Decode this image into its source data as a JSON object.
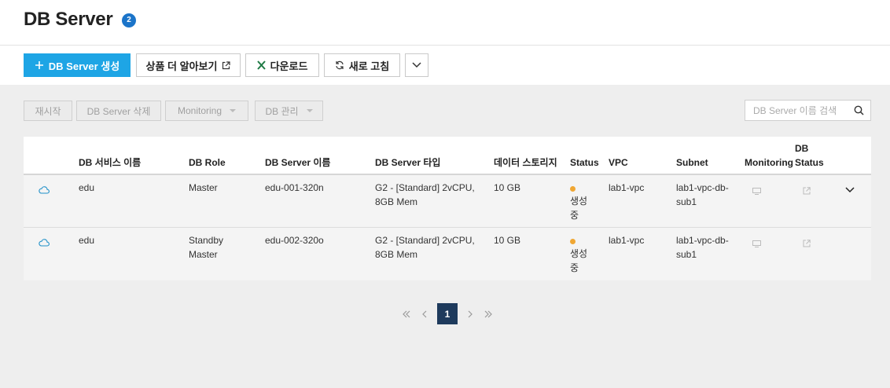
{
  "header": {
    "title": "DB Server",
    "count": "2"
  },
  "toolbar": {
    "create_label": "DB Server 생성",
    "learn_more_label": "상품 더 알아보기",
    "download_label": "다운로드",
    "refresh_label": "새로 고침"
  },
  "actions": {
    "restart_label": "재시작",
    "delete_label": "DB Server 삭제",
    "monitoring_label": "Monitoring",
    "db_manage_label": "DB 관리"
  },
  "search": {
    "placeholder": "DB Server 이름 검색"
  },
  "table": {
    "columns": {
      "service_name": "DB 서비스 이름",
      "role": "DB Role",
      "server_name": "DB Server 이름",
      "server_type": "DB Server 타입",
      "storage": "데이터 스토리지",
      "status": "Status",
      "vpc": "VPC",
      "subnet": "Subnet",
      "monitoring": "Monitoring",
      "db_status_1": "DB",
      "db_status_2": "Status"
    },
    "rows": [
      {
        "service_name": "edu",
        "role_1": "Master",
        "role_2": "",
        "server_name": "edu-001-320n",
        "server_type_1": "G2 - [Standard] 2vCPU,",
        "server_type_2": "8GB Mem",
        "storage": "10 GB",
        "status_1": "생성",
        "status_2": "중",
        "vpc": "lab1-vpc",
        "subnet_1": "lab1-vpc-db-",
        "subnet_2": "sub1"
      },
      {
        "service_name": "edu",
        "role_1": "Standby",
        "role_2": "Master",
        "server_name": "edu-002-320o",
        "server_type_1": "G2 - [Standard] 2vCPU,",
        "server_type_2": "8GB Mem",
        "storage": "10 GB",
        "status_1": "생성",
        "status_2": "중",
        "vpc": "lab1-vpc",
        "subnet_1": "lab1-vpc-db-",
        "subnet_2": "sub1"
      }
    ]
  },
  "pagination": {
    "current": "1"
  },
  "colors": {
    "primary": "#1ea5e5",
    "badge": "#1b74c9",
    "status_creating": "#f0a733",
    "page_active": "#1e3a5c"
  }
}
